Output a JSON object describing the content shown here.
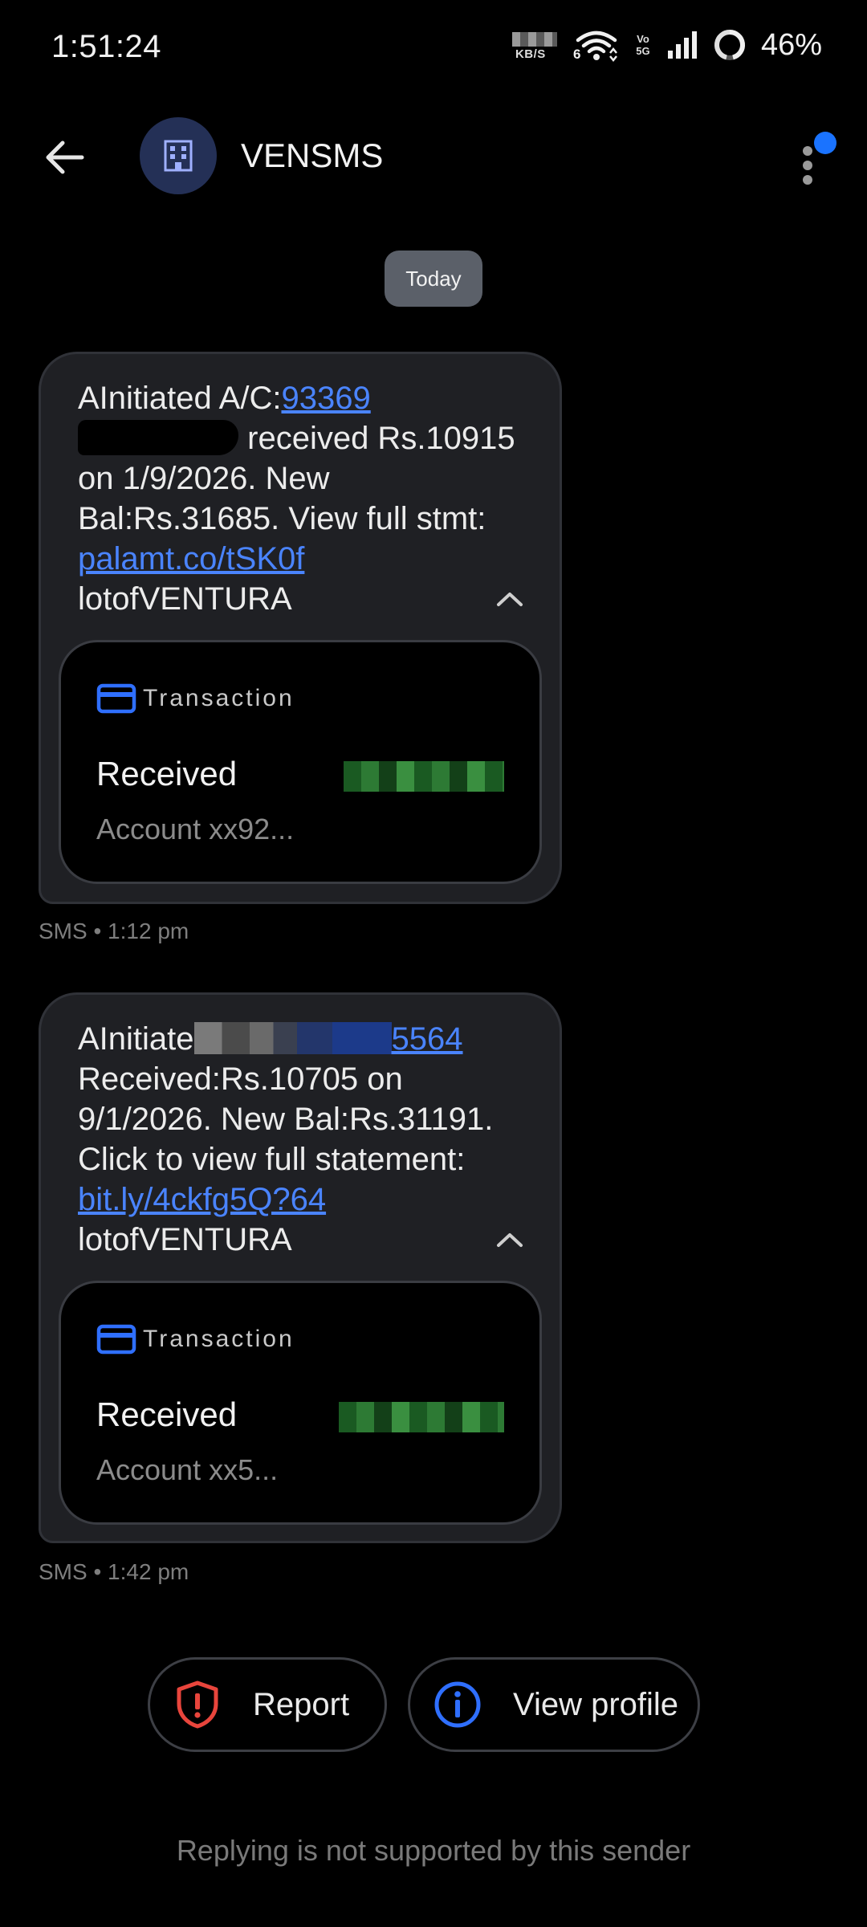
{
  "status_bar": {
    "time": "1:51:24",
    "speed_unit": "KB/S",
    "wifi_label": "6",
    "volte_label": "Vo 5G",
    "battery": "46%"
  },
  "header": {
    "contact_name": "VENSMS",
    "avatar_icon": "building-icon"
  },
  "date_chip": "Today",
  "messages": [
    {
      "text_prefix": "AInitiated A/C:",
      "account_link": "93369",
      "text_body": "received Rs.10915 on 1/9/2026. New Bal:Rs.31685. View full stmt:",
      "link": "palamt.co/tSK0f",
      "signature": "lotofVENTURA",
      "card": {
        "type_label": "Transaction",
        "status": "Received",
        "account": "Account xx92..."
      },
      "meta": "SMS • 1:12 pm"
    },
    {
      "text_prefix": "AInitiate",
      "account_link": "5564",
      "text_body": "Received:Rs.10705 on 9/1/2026. New Bal:Rs.31191. Click to view full statement:",
      "link": "bit.ly/4ckfg5Q?64",
      "signature": "lotofVENTURA",
      "card": {
        "type_label": "Transaction",
        "status": "Received",
        "account": "Account xx5..."
      },
      "meta": "SMS • 1:42 pm"
    }
  ],
  "actions": {
    "report_label": "Report",
    "view_profile_label": "View profile"
  },
  "footer": "Replying is not supported by this sender",
  "colors": {
    "accent": "#4a84ff",
    "report_red": "#e8453c",
    "card_blue": "#2f6fff",
    "bubble_bg": "#1f2024"
  }
}
